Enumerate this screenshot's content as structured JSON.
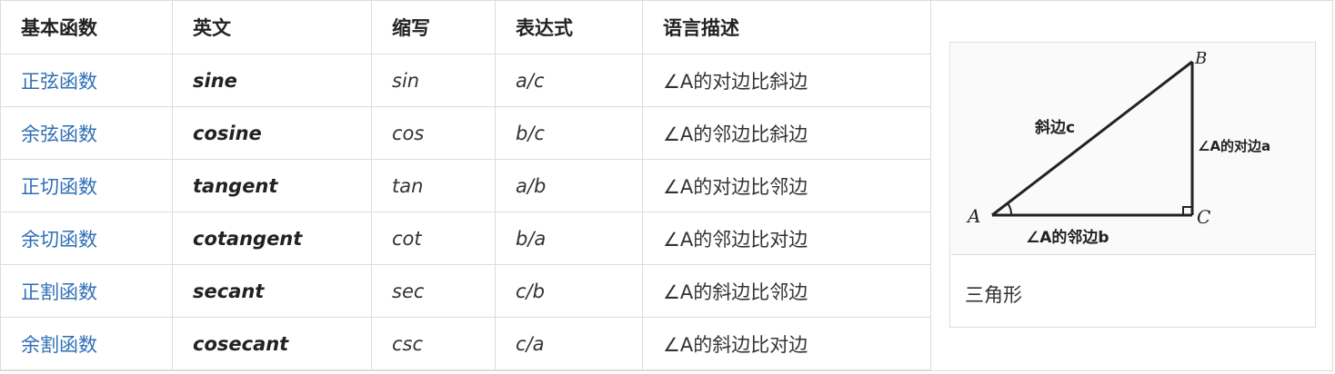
{
  "table": {
    "headers": [
      "基本函数",
      "英文",
      "缩写",
      "表达式",
      "语言描述"
    ],
    "rows": [
      {
        "name": "正弦函数",
        "english": "sine",
        "abbr": "sin",
        "expr": "a/c",
        "desc": "∠A的对边比斜边"
      },
      {
        "name": "余弦函数",
        "english": "cosine",
        "abbr": "cos",
        "expr": "b/c",
        "desc": "∠A的邻边比斜边"
      },
      {
        "name": "正切函数",
        "english": "tangent",
        "abbr": "tan",
        "expr": "a/b",
        "desc": "∠A的对边比邻边"
      },
      {
        "name": "余切函数",
        "english": "cotangent",
        "abbr": "cot",
        "expr": "b/a",
        "desc": "∠A的邻边比对边"
      },
      {
        "name": "正割函数",
        "english": "secant",
        "abbr": "sec",
        "expr": "c/b",
        "desc": "∠A的斜边比邻边"
      },
      {
        "name": "余割函数",
        "english": "cosecant",
        "abbr": "csc",
        "expr": "c/a",
        "desc": "∠A的斜边比对边"
      }
    ]
  },
  "figure": {
    "caption": "三角形",
    "labels": {
      "vertex_a": "A",
      "vertex_b": "B",
      "vertex_c": "C",
      "hypotenuse": "斜边c",
      "opposite": "∠A的对边a",
      "adjacent": "∠A的邻边b"
    }
  },
  "colors": {
    "link": "#2f6fb5",
    "border": "#dcdcdc",
    "text": "#222222"
  }
}
